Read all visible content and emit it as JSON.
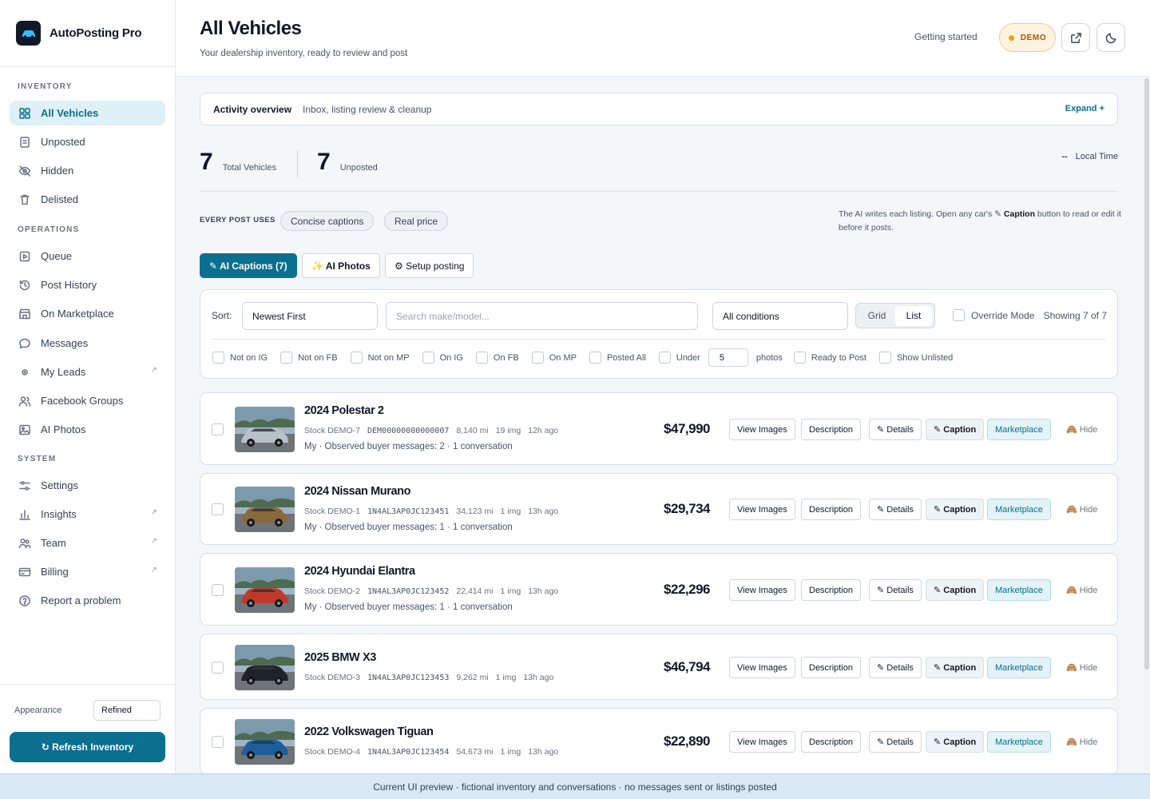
{
  "brand": {
    "name": "AutoPosting Pro"
  },
  "sidebar": {
    "sections": [
      {
        "title": "INVENTORY",
        "items": [
          {
            "label": "All Vehicles",
            "icon": "grid-icon",
            "active": true
          },
          {
            "label": "Unposted",
            "icon": "document-icon"
          },
          {
            "label": "Hidden",
            "icon": "eye-off-icon"
          },
          {
            "label": "Delisted",
            "icon": "trash-icon"
          }
        ]
      },
      {
        "title": "OPERATIONS",
        "items": [
          {
            "label": "Queue",
            "icon": "play-square-icon"
          },
          {
            "label": "Post History",
            "icon": "history-icon"
          },
          {
            "label": "On Marketplace",
            "icon": "store-icon"
          },
          {
            "label": "Messages",
            "icon": "chat-icon"
          },
          {
            "label": "My Leads",
            "icon": "dot-target-icon",
            "external": true
          },
          {
            "label": "Facebook Groups",
            "icon": "users-icon"
          },
          {
            "label": "AI Photos",
            "icon": "image-icon"
          }
        ]
      },
      {
        "title": "SYSTEM",
        "items": [
          {
            "label": "Settings",
            "icon": "sliders-icon"
          },
          {
            "label": "Insights",
            "icon": "bar-chart-icon",
            "external": true
          },
          {
            "label": "Team",
            "icon": "team-icon",
            "external": true
          },
          {
            "label": "Billing",
            "icon": "card-icon",
            "external": true
          },
          {
            "label": "Report a problem",
            "icon": "help-circle-icon"
          }
        ]
      }
    ],
    "appearance_label": "Appearance",
    "appearance_value": "Refined",
    "refresh_label": "↻ Refresh Inventory"
  },
  "header": {
    "title": "All Vehicles",
    "subtitle": "Your dealership inventory, ready to review and post",
    "getting_started": "Getting started",
    "demo_label": "DEMO"
  },
  "activity": {
    "title": "Activity overview",
    "subtitle": "Inbox, listing review & cleanup",
    "expand": "Expand +"
  },
  "stats": {
    "total_num": "7",
    "total_label": "Total Vehicles",
    "unposted_num": "7",
    "unposted_label": "Unposted",
    "time_dash": "--",
    "time_label": "Local Time"
  },
  "post_uses": {
    "label": "EVERY POST USES",
    "pills": [
      "Concise captions",
      "Real price"
    ],
    "note_pre": "The AI writes each listing. Open any car's ✎ ",
    "note_bold": "Caption",
    "note_post": " button to read or edit it before it posts."
  },
  "tools": {
    "captions": "✎ AI Captions (7)",
    "photos": "✨ AI Photos",
    "setup": "⚙ Setup posting"
  },
  "filters": {
    "sort_label": "Sort:",
    "sort_value": "Newest First",
    "search_placeholder": "Search make/model...",
    "condition_value": "All conditions",
    "view_grid": "Grid",
    "view_list": "List",
    "override_label": "Override Mode",
    "showing": "Showing 7 of 7",
    "checkboxes": [
      "Not on IG",
      "Not on FB",
      "Not on MP",
      "On IG",
      "On FB",
      "On MP",
      "Posted All"
    ],
    "under_label": "Under",
    "under_value": "5",
    "photos_label": "photos",
    "ready_label": "Ready to Post",
    "unlisted_label": "Show Unlisted"
  },
  "row_actions": {
    "view_images": "View Images",
    "description": "Description",
    "details": "✎ Details",
    "caption": "✎ Caption",
    "marketplace": "Marketplace",
    "hide": "🙈 Hide"
  },
  "vehicles": [
    {
      "title": "2024 Polestar 2",
      "stock": "Stock DEMO-7",
      "vin": "DEM00000000000007",
      "miles": "8,140 mi",
      "imgs": "19 img",
      "ago": "12h ago",
      "sub": "My · Observed buyer messages: 2 · 1 conversation",
      "price": "$47,990",
      "car_color": "#b8c0c8"
    },
    {
      "title": "2024 Nissan Murano",
      "stock": "Stock DEMO-1",
      "vin": "1N4AL3AP0JC123451",
      "miles": "34,123 mi",
      "imgs": "1 img",
      "ago": "13h ago",
      "sub": "My · Observed buyer messages: 1 · 1 conversation",
      "price": "$29,734",
      "car_color": "#8a6a3c"
    },
    {
      "title": "2024 Hyundai Elantra",
      "stock": "Stock DEMO-2",
      "vin": "1N4AL3AP0JC123452",
      "miles": "22,414 mi",
      "imgs": "1 img",
      "ago": "13h ago",
      "sub": "My · Observed buyer messages: 1 · 1 conversation",
      "price": "$22,296",
      "car_color": "#c0392b"
    },
    {
      "title": "2025 BMW X3",
      "stock": "Stock DEMO-3",
      "vin": "1N4AL3AP0JC123453",
      "miles": "9,262 mi",
      "imgs": "1 img",
      "ago": "13h ago",
      "sub": "",
      "price": "$46,794",
      "car_color": "#1f2328"
    },
    {
      "title": "2022 Volkswagen Tiguan",
      "stock": "Stock DEMO-4",
      "vin": "1N4AL3AP0JC123454",
      "miles": "54,673 mi",
      "imgs": "1 img",
      "ago": "13h ago",
      "sub": "",
      "price": "$22,890",
      "car_color": "#1f5f99"
    }
  ],
  "footer": "Current UI preview · fictional inventory and conversations · no messages sent or listings posted"
}
